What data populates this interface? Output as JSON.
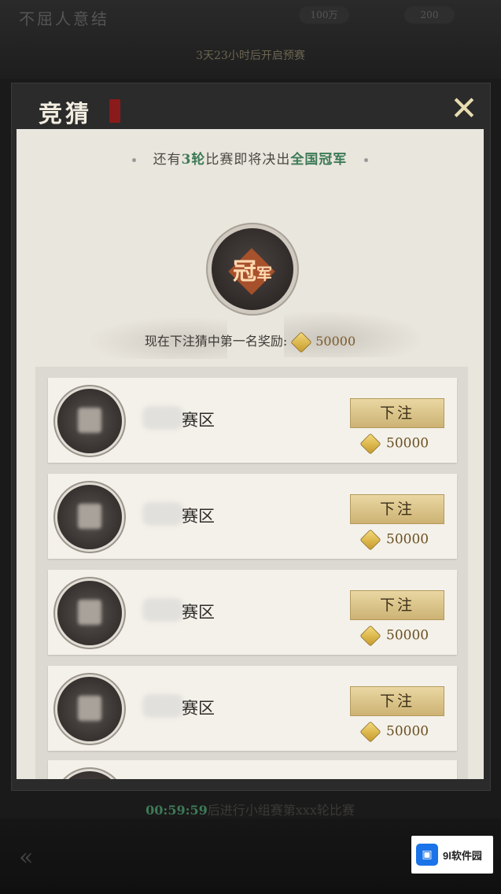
{
  "background": {
    "title": "不屈人意结",
    "countdown": "3天23小时后开启预赛",
    "res_a": "100万",
    "res_b": "200"
  },
  "dialog": {
    "title": "竞猜",
    "close_label": "✕"
  },
  "header": {
    "prefix": "还有",
    "rounds": "3轮",
    "middle": "比赛即将决出",
    "champion_label": "全国冠军"
  },
  "champion_badge": {
    "big": "冠",
    "small": "军"
  },
  "reward": {
    "label": "现在下注猜中第一名奖励:",
    "value": "50000"
  },
  "rows": [
    {
      "zone": "赛区",
      "bet_label": "下注",
      "cost": "50000"
    },
    {
      "zone": "赛区",
      "bet_label": "下注",
      "cost": "50000"
    },
    {
      "zone": "赛区",
      "bet_label": "下注",
      "cost": "50000"
    },
    {
      "zone": "赛区",
      "bet_label": "下注",
      "cost": "50000"
    }
  ],
  "footer": {
    "timer": "00:59:59",
    "text": "后进行小组赛第xxx轮比赛"
  },
  "watermark": {
    "text": "9l软件园"
  }
}
